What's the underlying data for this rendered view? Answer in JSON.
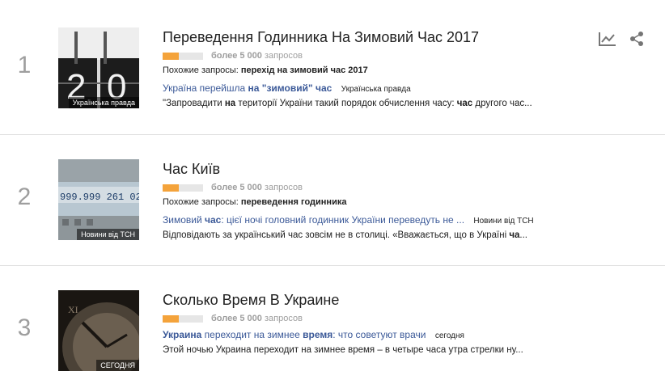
{
  "tools": {
    "explore_icon": "trend-chart-icon",
    "share_icon": "share-icon"
  },
  "trends": [
    {
      "rank": "1",
      "title": "Переведення Годинника На Зимовий Час 2017",
      "traffic_fill_percent": 40,
      "traffic_value": "более 5 000",
      "traffic_unit": "запросов",
      "related_label": "Похожие запросы:",
      "related_query": "перехід на зимовий час 2017",
      "image_caption": "Українська правда",
      "article_title_a": "Україна перейшла ",
      "article_title_b": "на \"зимовий\" час",
      "article_title_c": "",
      "article_title_d": "",
      "article_title_e": "",
      "article_source": "Українська правда",
      "snippet_a": "\"Запровадити ",
      "snippet_b": "на",
      "snippet_c": " території України такий порядок обчислення часу: ",
      "snippet_d": "час",
      "snippet_e": " другого час..."
    },
    {
      "rank": "2",
      "title": "Час Київ",
      "traffic_fill_percent": 40,
      "traffic_value": "более 5 000",
      "traffic_unit": "запросов",
      "related_label": "Похожие запросы:",
      "related_query": "переведення годинника",
      "image_caption": "Новини від ТСН",
      "article_title_a": "Зимовий ",
      "article_title_b": "час",
      "article_title_c": ": цієї ночі головний годинник України переведуть не ...",
      "article_title_d": "",
      "article_title_e": "",
      "article_source": "Новини від ТСН",
      "snippet_a": "Відповідають за український час зовсім не в столиці. «Вважається, що в Україні ",
      "snippet_b": "ча",
      "snippet_c": "...",
      "snippet_d": "",
      "snippet_e": ""
    },
    {
      "rank": "3",
      "title": "Сколько Время В Украине",
      "traffic_fill_percent": 40,
      "traffic_value": "более 5 000",
      "traffic_unit": "запросов",
      "related_label": "",
      "related_query": "",
      "image_caption": "СЕГОДНЯ",
      "article_title_a": "",
      "article_title_b": "Украина",
      "article_title_c": " переходит на зимнее ",
      "article_title_d": "время",
      "article_title_e": ": что советуют врачи",
      "article_source": "сегодня",
      "snippet_a": "Этой ночью Украина переходит на зимнее время – в четыре часа утра стрелки ну...",
      "snippet_b": "",
      "snippet_c": "",
      "snippet_d": "",
      "snippet_e": ""
    }
  ]
}
